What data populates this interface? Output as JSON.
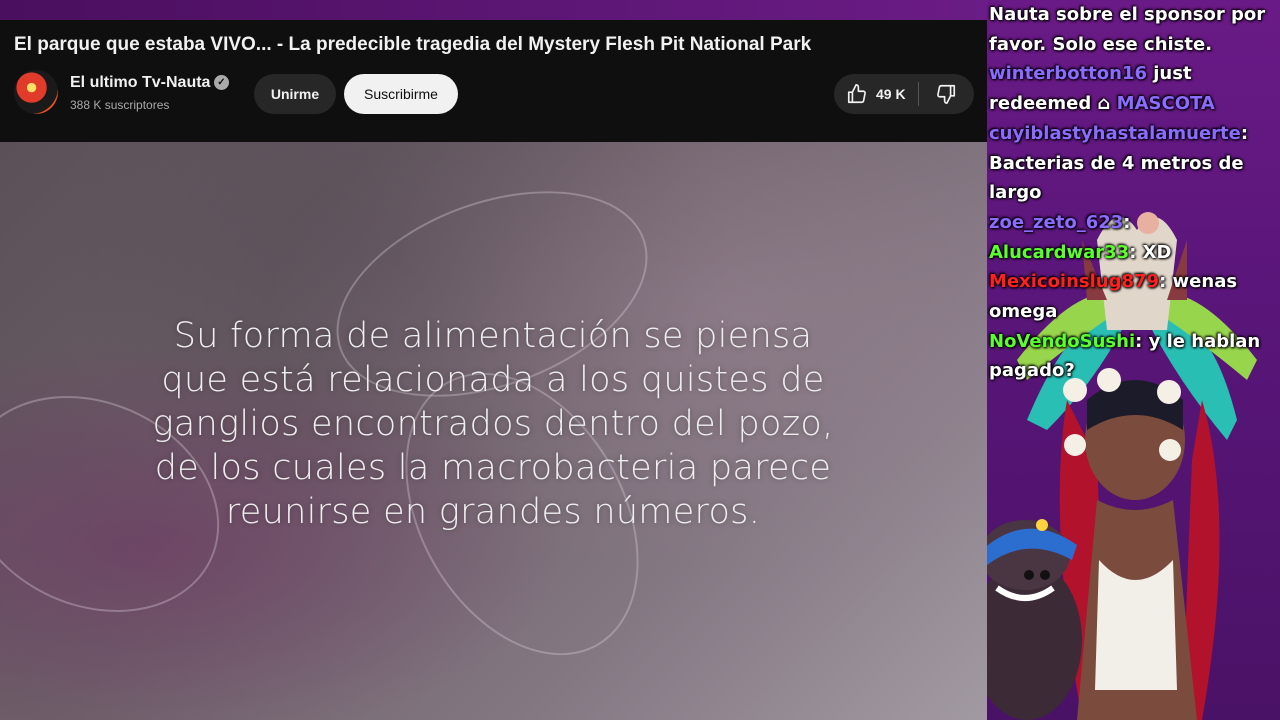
{
  "video": {
    "title": "El parque que estaba VIVO... - La predecible tragedia del Mystery Flesh Pit National Park",
    "channel_name": "El ultimo Tv-Nauta",
    "subscribers": "388 K suscriptores",
    "join_label": "Unirme",
    "subscribe_label": "Suscribirme",
    "like_count": "49 K",
    "caption_lines": [
      "Su forma de alimentación se piensa",
      "que está relacionada a los quistes de",
      "ganglios encontrados dentro del pozo,",
      "de los cuales la macrobacteria parece",
      "reunirse en grandes números."
    ]
  },
  "chat": {
    "messages": [
      {
        "user": "",
        "user_color": "#ffffff",
        "text": "Nauta sobre el sponsor por favor. Solo ese chiste."
      },
      {
        "user": "winterbotton16",
        "user_color": "#8a6cff",
        "text": " just redeemed "
      },
      {
        "user": "",
        "user_color": "#ffffff",
        "text": "MASCOTA",
        "highlight": true
      },
      {
        "user": "cuyiblastyhastalamuerte",
        "user_color": "#8a6cff",
        "text": ": Bacterias de 4 metros de largo"
      },
      {
        "user": "zoe_zeto_623",
        "user_color": "#8a6cff",
        "text": ": "
      },
      {
        "user": "Alucardwar33",
        "user_color": "#5bff2e",
        "text": ": XD"
      },
      {
        "user": "Mexicoinslug879",
        "user_color": "#ff2020",
        "text": ": wenas omega"
      },
      {
        "user": "NoVendoSushi",
        "user_color": "#5bff2e",
        "text": ": y le hablan pagado?"
      }
    ]
  },
  "colors": {
    "yt_background": "#0f0f0f",
    "stream_background": "#5c1573",
    "chat_purple": "#8a6cff",
    "chat_green": "#5bff2e",
    "chat_red": "#ff2020"
  },
  "icons": [
    "verified-icon",
    "like-icon",
    "dislike-icon"
  ]
}
